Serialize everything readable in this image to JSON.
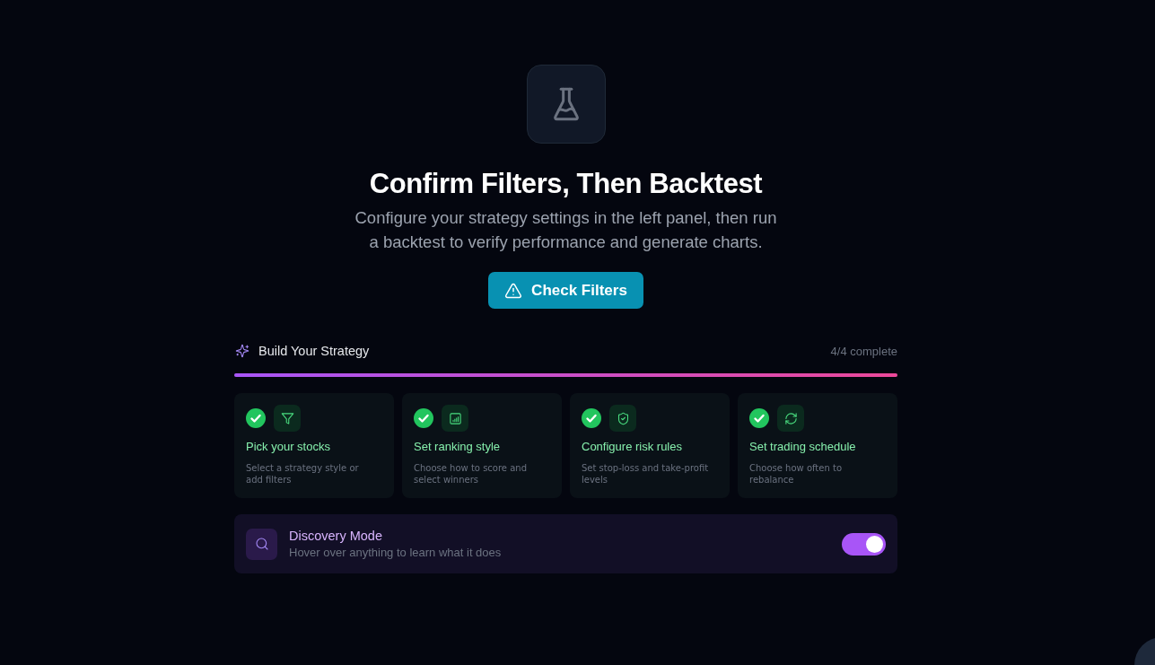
{
  "hero": {
    "title": "Confirm Filters, Then Backtest",
    "description": "Configure your strategy settings in the left panel, then run a backtest to verify performance and generate charts.",
    "button": "Check Filters"
  },
  "progress": {
    "title": "Build Your Strategy",
    "count": "4/4 complete",
    "level": 1
  },
  "steps": [
    {
      "kind": "filter",
      "title": "Pick your stocks",
      "description": "Select a strategy style or add filters",
      "done": true
    },
    {
      "kind": "ranking",
      "title": "Set ranking style",
      "description": "Choose how to score and select winners",
      "done": true
    },
    {
      "kind": "risk",
      "title": "Configure risk rules",
      "description": "Set stop-loss and take-profit levels",
      "done": true
    },
    {
      "kind": "schedule",
      "title": "Set trading schedule",
      "description": "Choose how often to rebalance",
      "done": true
    }
  ],
  "discovery": {
    "title": "Discovery Mode",
    "description": "Hover over anything to learn what it does",
    "on": true
  }
}
